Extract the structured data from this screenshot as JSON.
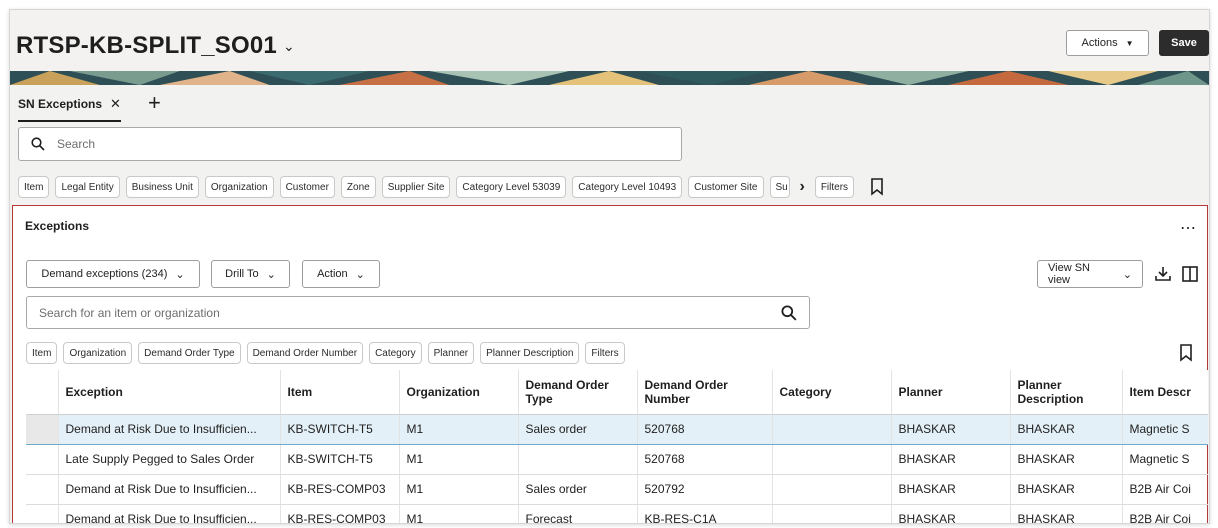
{
  "header": {
    "title": "RTSP-KB-SPLIT_SO01",
    "actions_label": "Actions",
    "save_label": "Save"
  },
  "tabs": [
    {
      "label": "SN Exceptions"
    }
  ],
  "search": {
    "placeholder": "Search"
  },
  "filters_top": [
    "Item",
    "Legal Entity",
    "Business Unit",
    "Organization",
    "Customer",
    "Zone",
    "Supplier Site",
    "Category Level 53039",
    "Category Level 10493",
    "Customer Site",
    "Su"
  ],
  "filters_top_more": "Filters",
  "panel": {
    "title": "Exceptions",
    "demand_exceptions": "Demand exceptions (234)",
    "drill_to": "Drill To",
    "action": "Action",
    "view": "View SN view",
    "search_placeholder": "Search for an item or organization",
    "filters": [
      "Item",
      "Organization",
      "Demand Order Type",
      "Demand Order Number",
      "Category",
      "Planner",
      "Planner Description"
    ],
    "filters_more": "Filters"
  },
  "table": {
    "columns": [
      "Exception",
      "Item",
      "Organization",
      "Demand Order Type",
      "Demand Order Number",
      "Category",
      "Planner",
      "Planner Description",
      "Item Descr"
    ],
    "rows": [
      [
        "Demand at Risk Due to Insufficien...",
        "KB-SWITCH-T5",
        "M1",
        "Sales order",
        "520768",
        "",
        "BHASKAR",
        "BHASKAR",
        "Magnetic S"
      ],
      [
        "Late Supply Pegged to Sales Order",
        "KB-SWITCH-T5",
        "M1",
        "",
        "520768",
        "",
        "BHASKAR",
        "BHASKAR",
        "Magnetic S"
      ],
      [
        "Demand at Risk Due to Insufficien...",
        "KB-RES-COMP03",
        "M1",
        "Sales order",
        "520792",
        "",
        "BHASKAR",
        "BHASKAR",
        "B2B Air Coi"
      ],
      [
        "Demand at Risk Due to Insufficien...",
        "KB-RES-COMP03",
        "M1",
        "Forecast",
        "KB-RES-C1A",
        "",
        "BHASKAR",
        "BHASKAR",
        "B2B Air Coi"
      ]
    ],
    "selected_row": 0
  },
  "colors": {
    "panel_border": "#b43a3a",
    "selected_row": "#e4f0f7",
    "save_button": "#2c2c2c"
  }
}
